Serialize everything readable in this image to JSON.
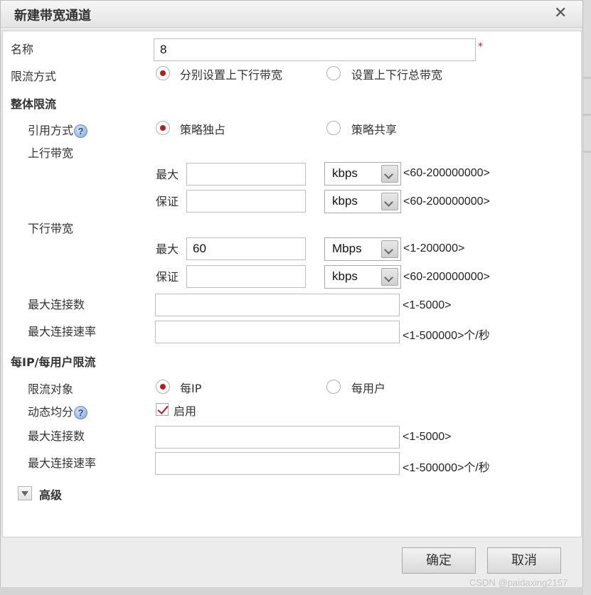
{
  "dialog": {
    "title": "新建带宽通道",
    "close": "✕"
  },
  "name": {
    "label": "名称",
    "value": "8",
    "required_mark": "*"
  },
  "limit_mode": {
    "label": "限流方式",
    "options": [
      "分别设置上下行带宽",
      "设置上下行总带宽"
    ],
    "selected": "分别设置上下行带宽"
  },
  "overall": {
    "heading": "整体限流",
    "ref_mode": {
      "label": "引用方式",
      "help": "?",
      "options": [
        "策略独占",
        "策略共享"
      ],
      "selected": "策略独占"
    },
    "upstream": {
      "label": "上行带宽",
      "max": {
        "label": "最大",
        "value": "",
        "unit": "kbps",
        "hint": "<60-200000000>"
      },
      "guarantee": {
        "label": "保证",
        "value": "",
        "unit": "kbps",
        "hint": "<60-200000000>"
      }
    },
    "downstream": {
      "label": "下行带宽",
      "max": {
        "label": "最大",
        "value": "60",
        "unit": "Mbps",
        "hint": "<1-200000>"
      },
      "guarantee": {
        "label": "保证",
        "value": "",
        "unit": "kbps",
        "hint": "<60-200000000>"
      }
    },
    "max_conn": {
      "label": "最大连接数",
      "value": "",
      "hint": "<1-5000>"
    },
    "max_conn_rate": {
      "label": "最大连接速率",
      "value": "",
      "hint": "<1-500000>个/秒"
    }
  },
  "per_ip": {
    "heading": "每IP/每用户限流",
    "target": {
      "label": "限流对象",
      "options": [
        "每IP",
        "每用户"
      ],
      "selected": "每IP"
    },
    "dynamic": {
      "label": "动态均分",
      "help": "?",
      "checkbox_label": "启用",
      "checked": true
    },
    "max_conn": {
      "label": "最大连接数",
      "value": "",
      "hint": "<1-5000>"
    },
    "max_conn_rate": {
      "label": "最大连接速率",
      "value": "",
      "hint": "<1-500000>个/秒"
    }
  },
  "advanced": {
    "label": "高级"
  },
  "buttons": {
    "ok": "确定",
    "cancel": "取消"
  },
  "watermark": "CSDN @paidaxing2157",
  "colors": {
    "radio_selected": "#b81c1c",
    "required": "#e02020"
  }
}
